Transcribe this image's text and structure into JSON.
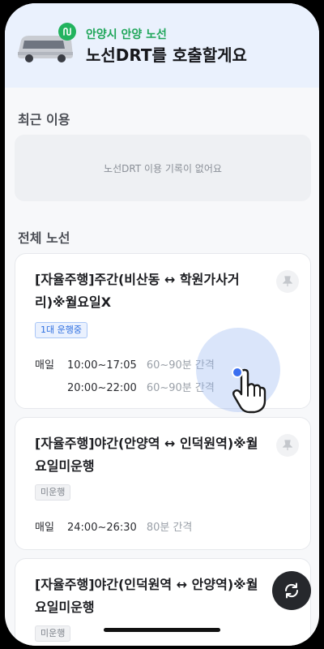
{
  "header": {
    "subtitle": "안양시 안양 노선",
    "title": "노선DRT를 호출할게요",
    "accent_color": "#1fa65a",
    "vehicle_icon": "van-icon",
    "route_icon": "route-icon"
  },
  "recent": {
    "title": "최근 이용",
    "empty_text": "노선DRT 이용 기록이 없어요"
  },
  "all_routes": {
    "title": "전체 노선",
    "cards": [
      {
        "title": "[자율주행]주간(비산동 ↔ 학원가사거리)※월요일X",
        "badge": "1대 운행중",
        "badge_status": "running",
        "schedule": [
          {
            "label": "매일",
            "time": "10:00~17:05",
            "interval": "60~90분 간격"
          },
          {
            "label": "",
            "time": "20:00~22:00",
            "interval": "60~90분 간격"
          }
        ]
      },
      {
        "title": "[자율주행]야간(안양역 ↔ 인덕원역)※월요일미운행",
        "badge": "미운행",
        "badge_status": "stopped",
        "schedule": [
          {
            "label": "매일",
            "time": "24:00~26:30",
            "interval": "80분 간격"
          }
        ]
      },
      {
        "title": "[자율주행]야간(인덕원역 ↔ 안양역)※월요일미운행",
        "badge": "미운행",
        "badge_status": "stopped",
        "schedule": []
      }
    ]
  },
  "fab_icon": "refresh-icon",
  "pin_icon": "pin-icon"
}
